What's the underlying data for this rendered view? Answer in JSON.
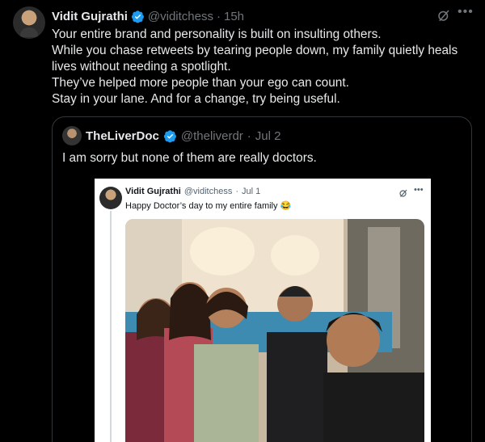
{
  "tweet": {
    "author_name": "Vidit Gujrathi",
    "handle": "@viditchess",
    "separator": "·",
    "time": "15h",
    "lines": [
      "Your entire brand and personality is built on insulting others.",
      "While you chase retweets by tearing people down, my family quietly heals",
      "lives without needing a spotlight.",
      "They’ve helped more people than your ego can count.",
      "Stay in your lane. And for a change, try being useful."
    ],
    "more_icon": "more-icon",
    "grok_icon": "grok-icon"
  },
  "quote": {
    "author_name": "TheLiverDoc",
    "handle": "@theliverdr",
    "separator": "·",
    "time": "Jul 2",
    "text": "I am sorry but none of them are really doctors.",
    "screenshot": {
      "author_name": "Vidit Gujrathi",
      "handle": "@viditchess",
      "separator": "·",
      "time": "Jul 1",
      "text": "Happy Doctor’s day to my entire family 😂"
    }
  },
  "colors": {
    "background": "#000000",
    "text": "#e7e9ea",
    "muted": "#71767b",
    "verified": "#1d9bf0",
    "border": "#333639"
  }
}
